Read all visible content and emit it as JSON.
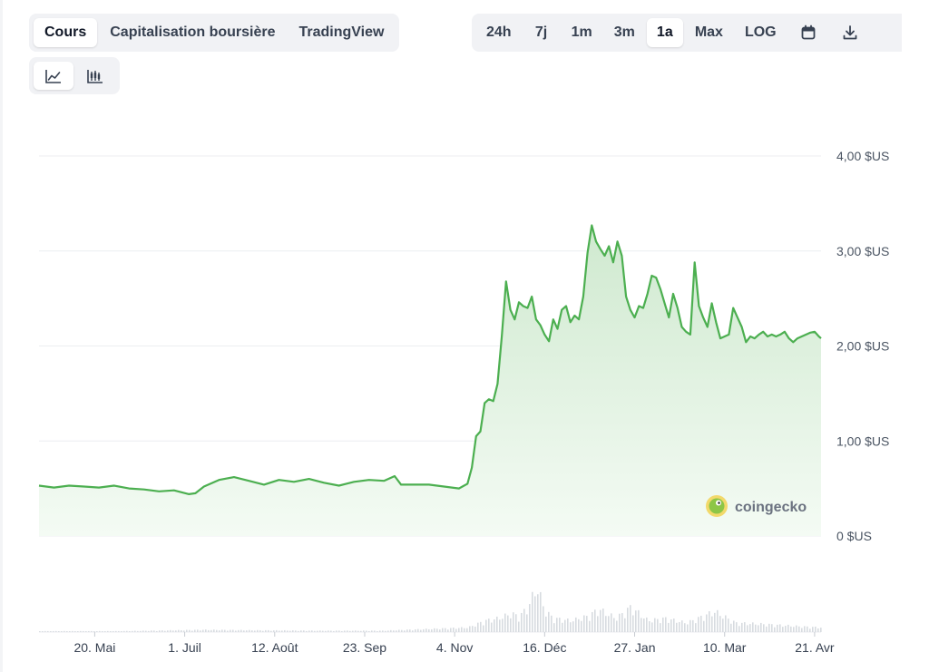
{
  "tabs": {
    "items": [
      {
        "label": "Cours",
        "active": true
      },
      {
        "label": "Capitalisation boursière",
        "active": false
      },
      {
        "label": "TradingView",
        "active": false
      }
    ]
  },
  "ranges": {
    "items": [
      {
        "label": "24h",
        "active": false
      },
      {
        "label": "7j",
        "active": false
      },
      {
        "label": "1m",
        "active": false
      },
      {
        "label": "3m",
        "active": false
      },
      {
        "label": "1a",
        "active": true
      },
      {
        "label": "Max",
        "active": false
      },
      {
        "label": "LOG",
        "active": false
      }
    ],
    "calendar_icon": "calendar-icon",
    "download_icon": "download-icon"
  },
  "chart_style": {
    "line_icon": "line-chart-icon",
    "candle_icon": "candlestick-chart-icon",
    "active": "line"
  },
  "watermark": {
    "text": "coingecko",
    "icon": "coingecko-logo-icon"
  },
  "colors": {
    "line": "#4caf50",
    "fill_top": "#cfe9cf",
    "fill_bottom": "#f4fbf4",
    "grid": "#eceef1",
    "volume": "#d7dbe0"
  },
  "chart_data": {
    "type": "area",
    "title": "",
    "xlabel": "",
    "ylabel": "",
    "ylim": [
      0,
      4
    ],
    "yticks": [
      0,
      1,
      2,
      3,
      4
    ],
    "ytick_labels": [
      "0 $US",
      "1,00 $US",
      "2,00 $US",
      "3,00 $US",
      "4,00 $US"
    ],
    "x_range": [
      "2024-04-24",
      "2025-04-24"
    ],
    "xticks": [
      {
        "date": "2024-05-20",
        "label": "20. Mai"
      },
      {
        "date": "2024-07-01",
        "label": "1. Juil"
      },
      {
        "date": "2024-08-12",
        "label": "12. Août"
      },
      {
        "date": "2024-09-23",
        "label": "23. Sep"
      },
      {
        "date": "2024-11-04",
        "label": "4. Nov"
      },
      {
        "date": "2024-12-16",
        "label": "16. Déc"
      },
      {
        "date": "2025-01-27",
        "label": "27. Jan"
      },
      {
        "date": "2025-03-10",
        "label": "10. Mar"
      },
      {
        "date": "2025-04-21",
        "label": "21. Avr"
      }
    ],
    "grid": true,
    "legend": "none",
    "series": [
      {
        "x": [
          "2024-04-24",
          "2024-05-01",
          "2024-05-08",
          "2024-05-15",
          "2024-05-22",
          "2024-05-29",
          "2024-06-05",
          "2024-06-12",
          "2024-06-19",
          "2024-06-26",
          "2024-07-03",
          "2024-07-06",
          "2024-07-10",
          "2024-07-17",
          "2024-07-24",
          "2024-07-31",
          "2024-08-07",
          "2024-08-14",
          "2024-08-21",
          "2024-08-28",
          "2024-09-04",
          "2024-09-11",
          "2024-09-18",
          "2024-09-25",
          "2024-10-02",
          "2024-10-07",
          "2024-10-10",
          "2024-10-16",
          "2024-10-23",
          "2024-10-30",
          "2024-11-06",
          "2024-11-10",
          "2024-11-12",
          "2024-11-14",
          "2024-11-16",
          "2024-11-18",
          "2024-11-20",
          "2024-11-22",
          "2024-11-24",
          "2024-11-26",
          "2024-11-28",
          "2024-11-30",
          "2024-12-02",
          "2024-12-04",
          "2024-12-06",
          "2024-12-08",
          "2024-12-10",
          "2024-12-12",
          "2024-12-14",
          "2024-12-16",
          "2024-12-18",
          "2024-12-20",
          "2024-12-22",
          "2024-12-24",
          "2024-12-26",
          "2024-12-28",
          "2024-12-30",
          "2025-01-01",
          "2025-01-03",
          "2025-01-05",
          "2025-01-07",
          "2025-01-09",
          "2025-01-11",
          "2025-01-13",
          "2025-01-15",
          "2025-01-17",
          "2025-01-19",
          "2025-01-21",
          "2025-01-23",
          "2025-01-25",
          "2025-01-27",
          "2025-01-29",
          "2025-01-31",
          "2025-02-02",
          "2025-02-04",
          "2025-02-06",
          "2025-02-08",
          "2025-02-10",
          "2025-02-12",
          "2025-02-14",
          "2025-02-16",
          "2025-02-18",
          "2025-02-20",
          "2025-02-22",
          "2025-02-24",
          "2025-02-26",
          "2025-02-28",
          "2025-03-02",
          "2025-03-04",
          "2025-03-05",
          "2025-03-06",
          "2025-03-08",
          "2025-03-10",
          "2025-03-12",
          "2025-03-14",
          "2025-03-16",
          "2025-03-18",
          "2025-03-20",
          "2025-03-22",
          "2025-03-24",
          "2025-03-26",
          "2025-03-28",
          "2025-03-30",
          "2025-04-01",
          "2025-04-03",
          "2025-04-05",
          "2025-04-07",
          "2025-04-09",
          "2025-04-11",
          "2025-04-13",
          "2025-04-15",
          "2025-04-17",
          "2025-04-19",
          "2025-04-21",
          "2025-04-23",
          "2025-04-24"
        ],
        "y": [
          0.53,
          0.51,
          0.53,
          0.52,
          0.51,
          0.53,
          0.5,
          0.49,
          0.47,
          0.48,
          0.44,
          0.45,
          0.52,
          0.59,
          0.62,
          0.58,
          0.54,
          0.59,
          0.57,
          0.6,
          0.56,
          0.53,
          0.57,
          0.59,
          0.58,
          0.63,
          0.54,
          0.54,
          0.54,
          0.52,
          0.5,
          0.55,
          0.72,
          1.05,
          1.1,
          1.4,
          1.44,
          1.42,
          1.6,
          2.1,
          2.68,
          2.38,
          2.28,
          2.46,
          2.42,
          2.4,
          2.52,
          2.28,
          2.22,
          2.12,
          2.05,
          2.28,
          2.18,
          2.38,
          2.42,
          2.25,
          2.32,
          2.28,
          2.52,
          2.98,
          3.27,
          3.1,
          3.02,
          2.95,
          3.05,
          2.88,
          3.1,
          2.95,
          2.52,
          2.38,
          2.3,
          2.42,
          2.4,
          2.55,
          2.74,
          2.72,
          2.6,
          2.45,
          2.3,
          2.55,
          2.4,
          2.2,
          2.15,
          2.12,
          2.88,
          2.42,
          2.3,
          2.2,
          2.45,
          2.35,
          2.25,
          2.08,
          2.1,
          2.12,
          2.4,
          2.3,
          2.2,
          2.04,
          2.1,
          2.08,
          2.12,
          2.15,
          2.1,
          2.12,
          2.1,
          2.12,
          2.15,
          2.08,
          2.04,
          2.08,
          2.1,
          2.12,
          2.14,
          2.15,
          2.1,
          2.08
        ]
      }
    ],
    "volume": {
      "x": [
        "2024-04-24",
        "2024-06-01",
        "2024-07-10",
        "2024-08-01",
        "2024-09-01",
        "2024-10-01",
        "2024-11-10",
        "2024-11-18",
        "2024-11-24",
        "2024-11-30",
        "2024-12-04",
        "2024-12-08",
        "2024-12-12",
        "2024-12-16",
        "2024-12-20",
        "2024-12-28",
        "2025-01-05",
        "2025-01-10",
        "2025-01-18",
        "2025-01-25",
        "2025-02-02",
        "2025-02-10",
        "2025-02-20",
        "2025-03-05",
        "2025-03-15",
        "2025-03-25",
        "2025-04-05",
        "2025-04-15",
        "2025-04-24"
      ],
      "y": [
        0.02,
        0.02,
        0.05,
        0.04,
        0.03,
        0.03,
        0.1,
        0.25,
        0.3,
        0.4,
        0.35,
        0.55,
        1.0,
        0.45,
        0.3,
        0.25,
        0.35,
        0.5,
        0.3,
        0.55,
        0.25,
        0.3,
        0.2,
        0.45,
        0.2,
        0.18,
        0.15,
        0.12,
        0.1
      ]
    }
  }
}
